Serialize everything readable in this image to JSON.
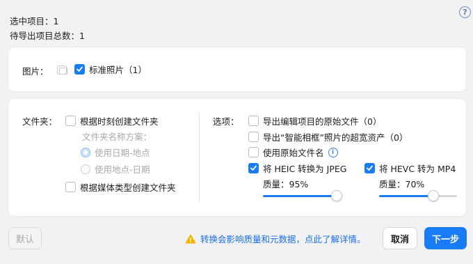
{
  "summary": {
    "selected_label": "选中项目：",
    "selected_count": "1",
    "total_label": "待导出项目总数：",
    "total_count": "1"
  },
  "help_icon": "?",
  "photos": {
    "label": "图片：",
    "standard_label": "标准照片",
    "standard_count": "（1）",
    "standard_checked": true
  },
  "folder": {
    "label": "文件夹：",
    "by_time_label": "根据时刻创建文件夹",
    "by_time_checked": false,
    "naming_label": "文件夹名称方案：",
    "naming_options": [
      "使用日期-地点",
      "使用地点-日期"
    ],
    "naming_selected": "使用日期-地点",
    "by_media_label": "根据媒体类型创建文件夹",
    "by_media_checked": false
  },
  "options": {
    "label": "选项：",
    "export_originals_label": "导出编辑项目的原始文件（0）",
    "export_smart_frame_label": "导出“智能相框”照片的超宽资产（0）",
    "use_original_filename_label": "使用原始文件名",
    "heic_label": "将 HEIC 转换为 JPEG",
    "heic_checked": true,
    "heic_quality_label": "质量：",
    "heic_quality_value": "95%",
    "heic_quality": 0.95,
    "hevc_label": "将 HEVC 转为 MP4",
    "hevc_checked": true,
    "hevc_quality_label": "质量：",
    "hevc_quality_value": "70%",
    "hevc_quality": 0.7
  },
  "footer": {
    "default_button": "默认",
    "warning_text": "转换会影响质量和元数据，点此了解详情。",
    "cancel_button": "取消",
    "next_button": "下一步"
  },
  "colors": {
    "accent": "#1a7cf5",
    "warning": "#f5b400",
    "background": "#f2f2f4"
  }
}
